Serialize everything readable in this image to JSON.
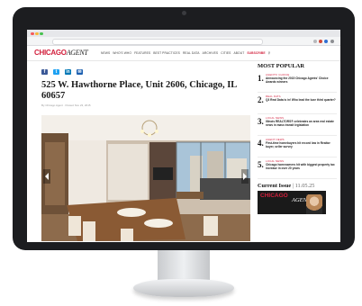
{
  "site": {
    "logo_primary": "CHICAGO",
    "logo_secondary": "AGENT",
    "nav": [
      "NEWS",
      "WHO'S WHO",
      "FEATURES",
      "BEST PRACTICES",
      "REAL DATA",
      "ARCHIVES",
      "CITIES",
      "ABOUT",
      "SUBSCRIBE"
    ]
  },
  "article": {
    "share": [
      {
        "icon": "facebook-icon",
        "glyph": "f",
        "color": "#3b5998"
      },
      {
        "icon": "twitter-icon",
        "glyph": "t",
        "color": "#1da1f2"
      },
      {
        "icon": "linkedin-icon",
        "glyph": "in",
        "color": "#0077b5"
      },
      {
        "icon": "email-icon",
        "glyph": "✉",
        "color": "#1c5fb0"
      }
    ],
    "title": "525 W. Hawthorne Place, Unit 2606, Chicago, IL 60657",
    "byline": "By Chicago Agent · Posted Nov 23, 2015"
  },
  "sidebar": {
    "heading": "MOST POPULAR",
    "items": [
      {
        "num": "1.",
        "category": "AGENTS' CHOICE",
        "headline": "Announcing the 2015 Chicago Agents' Choice Awards winners"
      },
      {
        "num": "2.",
        "category": "REAL DATA",
        "headline": "Q3 Real Data is in! Who lead the luxe third quarter?"
      },
      {
        "num": "3.",
        "category": "LOCAL NEWS",
        "headline": "Illinois REALTORS® celebrates an area real estate news in mass transit legislation"
      },
      {
        "num": "4.",
        "category": "AGENT NEWS",
        "headline": "First-time homebuyers hit record low in Realtor buyer, seller survey"
      },
      {
        "num": "5.",
        "category": "LOCAL NEWS",
        "headline": "Chicago homeowners hit with biggest property tax increase in over 20 years"
      }
    ],
    "issue_label": "Current Issue",
    "issue_date": "11.05.25",
    "cover_mark": "CHICAGO",
    "cover_name": "AGENT"
  },
  "colors": {
    "brand_red": "#d21f3c",
    "bezel": "#1c1d20"
  }
}
